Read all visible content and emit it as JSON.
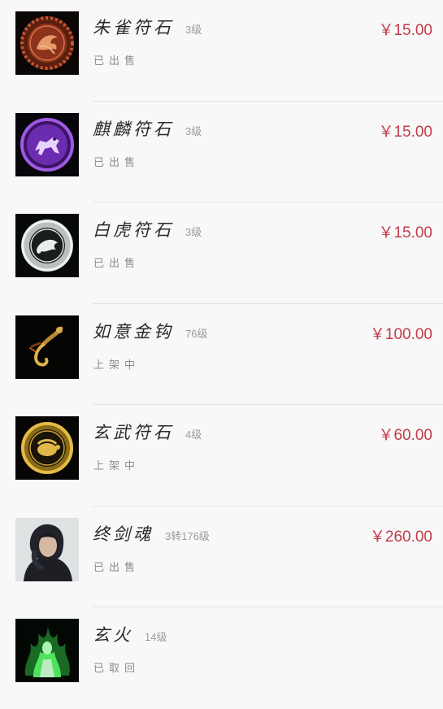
{
  "items": [
    {
      "name": "朱雀符石",
      "level": "3级",
      "status": "已出售",
      "price": "￥15.00",
      "icon": "vermilion-bird-talisman-icon"
    },
    {
      "name": "麒麟符石",
      "level": "3级",
      "status": "已出售",
      "price": "￥15.00",
      "icon": "qilin-talisman-icon"
    },
    {
      "name": "白虎符石",
      "level": "3级",
      "status": "已出售",
      "price": "￥15.00",
      "icon": "white-tiger-talisman-icon"
    },
    {
      "name": "如意金钩",
      "level": "76级",
      "status": "上架中",
      "price": "￥100.00",
      "icon": "golden-hook-icon"
    },
    {
      "name": "玄武符石",
      "level": "4级",
      "status": "上架中",
      "price": "￥60.00",
      "icon": "black-tortoise-talisman-icon"
    },
    {
      "name": "终剑魂",
      "level": "3转176级",
      "status": "已出售",
      "price": "￥260.00",
      "icon": "character-portrait"
    },
    {
      "name": "玄火",
      "level": "14级",
      "status": "已取回",
      "price": "",
      "icon": "mystic-fire-character-icon"
    }
  ],
  "colors": {
    "price": "#c23b4a",
    "status": "#8c8c8c",
    "level": "#9a9a9a",
    "divider": "#e3e4e3",
    "background": "#f7f8f7"
  }
}
